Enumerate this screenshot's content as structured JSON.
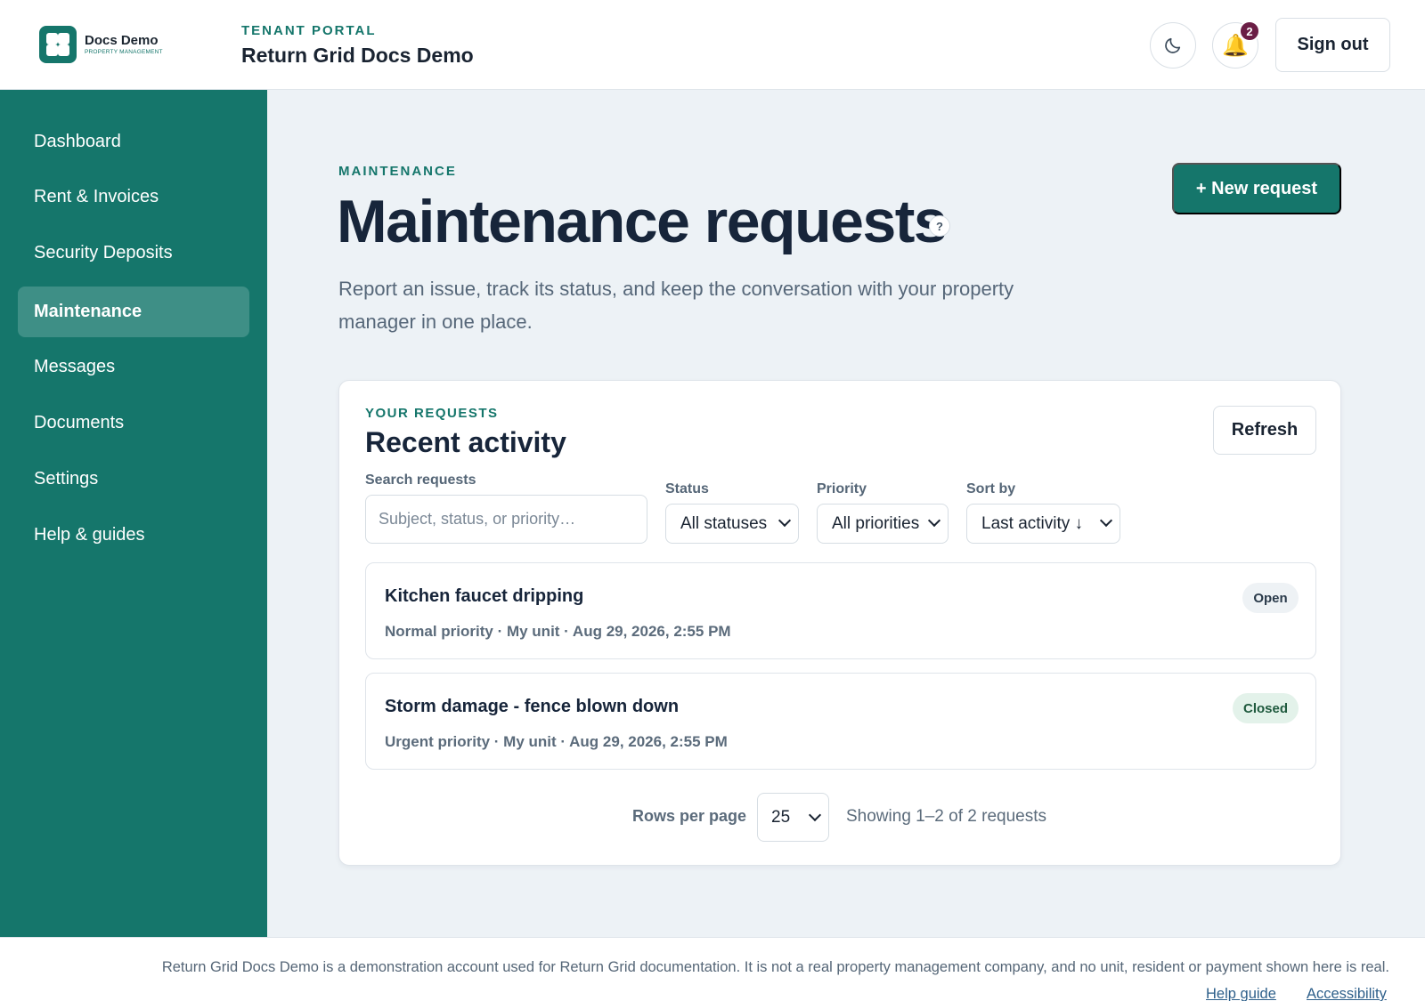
{
  "brand": {
    "name": "Docs Demo",
    "tagline": "PROPERTY MANAGEMENT"
  },
  "header": {
    "eyebrow": "TENANT PORTAL",
    "title": "Return Grid Docs Demo",
    "notification_count": "2",
    "sign_out_label": "Sign out"
  },
  "sidebar": {
    "items": [
      {
        "label": "Dashboard",
        "active": false
      },
      {
        "label": "Rent & Invoices",
        "active": false
      },
      {
        "label": "Security Deposits",
        "active": false
      },
      {
        "label": "Maintenance",
        "active": true
      },
      {
        "label": "Messages",
        "active": false
      },
      {
        "label": "Documents",
        "active": false
      },
      {
        "label": "Settings",
        "active": false
      },
      {
        "label": "Help & guides",
        "active": false
      }
    ]
  },
  "main": {
    "eyebrow": "MAINTENANCE",
    "title": "Maintenance requests",
    "help_icon": "?",
    "description": "Report an issue, track its status, and keep the conversation with your property manager in one place.",
    "new_request_label": "+ New request"
  },
  "card": {
    "eyebrow": "YOUR REQUESTS",
    "title": "Recent activity",
    "refresh_label": "Refresh",
    "search": {
      "label": "Search requests",
      "placeholder": "Subject, status, or priority…",
      "value": ""
    },
    "status": {
      "label": "Status",
      "selected": "All statuses"
    },
    "priority": {
      "label": "Priority",
      "selected": "All priorities"
    },
    "sort": {
      "label": "Sort by",
      "selected": "Last activity ↓"
    },
    "requests": [
      {
        "title": "Kitchen faucet dripping",
        "meta": "Normal priority · My unit · Aug 29, 2026, 2:55 PM",
        "status": "Open"
      },
      {
        "title": "Storm damage - fence blown down",
        "meta": "Urgent priority · My unit · Aug 29, 2026, 2:55 PM",
        "status": "Closed"
      }
    ],
    "pagination": {
      "rows_label": "Rows per page",
      "rows_value": "25",
      "showing": "Showing 1–2 of 2 requests"
    }
  },
  "footer": {
    "note": "Return Grid Docs Demo is a demonstration account used for Return Grid documentation. It is not a real property management company, and no unit, resident or payment shown here is real.",
    "links": [
      "Help guide",
      "Accessibility"
    ]
  },
  "colors": {
    "brand_teal": "#15766b",
    "sidebar_active": "#3e8f86",
    "notification_badge": "#6b1e45",
    "open_badge_bg": "#eef2f5",
    "closed_badge_bg": "#e3f2ea"
  },
  "icons": [
    "app-logo-icon",
    "moon-icon",
    "bell-icon",
    "question-icon",
    "chevron-down-icon"
  ]
}
